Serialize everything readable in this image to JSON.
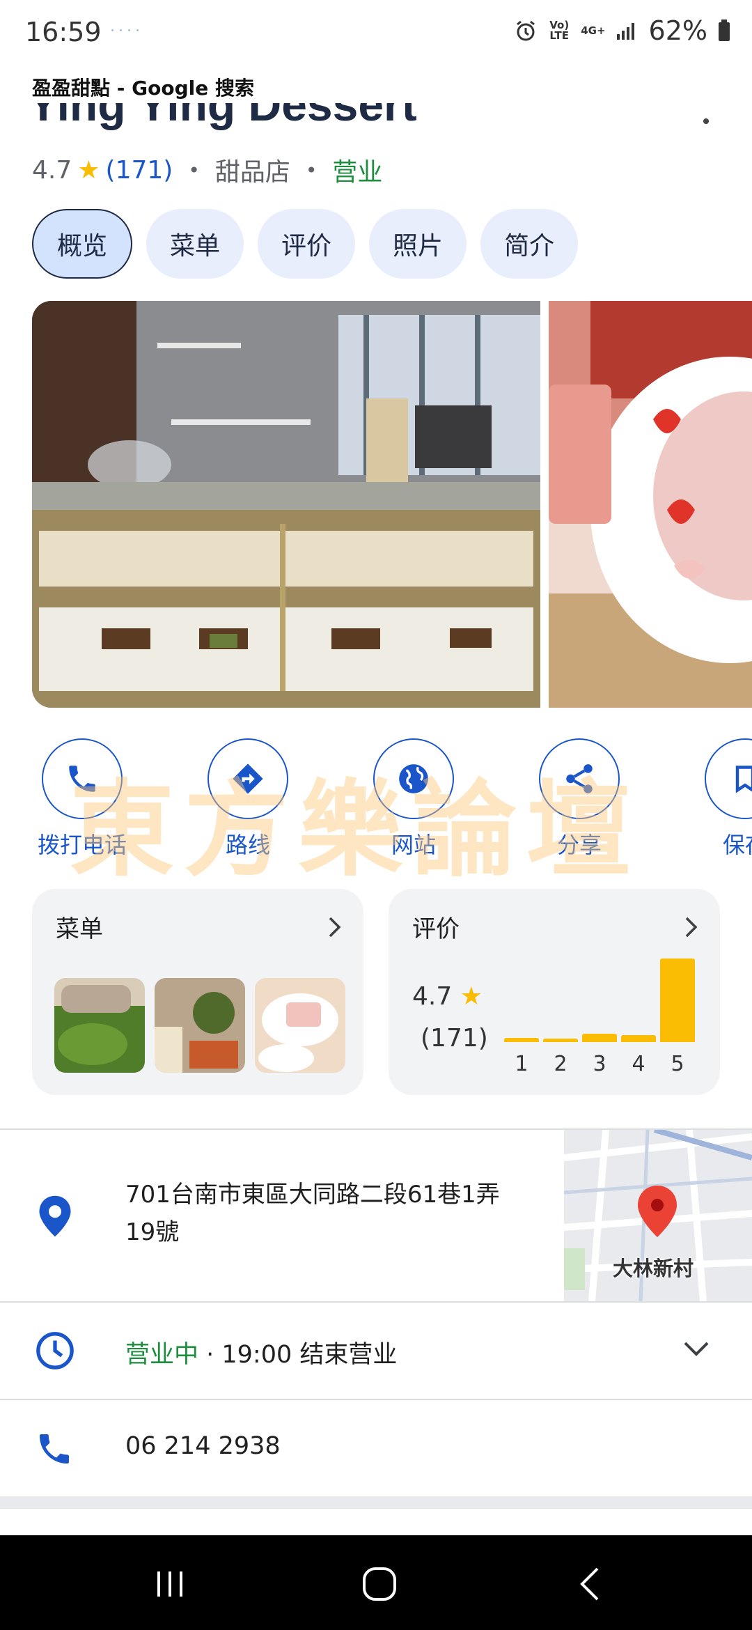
{
  "status_bar": {
    "time": "16:59",
    "dots": "˙˙˙˙",
    "volte": "Vo) LTE",
    "network": "4G+",
    "battery": "62%"
  },
  "header": {
    "title": "盈盈甜點 - Google 搜索",
    "business_name": "Ying Ying Dessert"
  },
  "rating_row": {
    "rating": "4.7",
    "count": "(171)",
    "category": "甜品店",
    "status": "营业"
  },
  "tabs": [
    {
      "label": "概览",
      "active": true
    },
    {
      "label": "菜单"
    },
    {
      "label": "评价"
    },
    {
      "label": "照片"
    },
    {
      "label": "简介"
    }
  ],
  "actions": [
    {
      "label": "拨打电话",
      "icon": "phone-icon"
    },
    {
      "label": "路线",
      "icon": "directions-icon"
    },
    {
      "label": "网站",
      "icon": "globe-icon"
    },
    {
      "label": "分享",
      "icon": "share-icon"
    },
    {
      "label": "保存",
      "icon": "bookmark-icon"
    }
  ],
  "watermark": "東方樂論壇",
  "menu_card": {
    "title": "菜单"
  },
  "reviews_card": {
    "title": "评价",
    "rating": "4.7",
    "count": "(171)",
    "distribution": [
      {
        "label": "1",
        "value": 0.05
      },
      {
        "label": "2",
        "value": 0.04
      },
      {
        "label": "3",
        "value": 0.1
      },
      {
        "label": "4",
        "value": 0.08
      },
      {
        "label": "5",
        "value": 1.0
      }
    ]
  },
  "address": {
    "line1": "701台南市東區大同路二段61巷1弄",
    "line2": "19號",
    "map_label": "大林新村"
  },
  "hours": {
    "open": "营业中",
    "rest": " · 19:00 结束营业"
  },
  "phone": {
    "number": "06 214 2938"
  },
  "colors": {
    "accent": "#1a56c9",
    "star": "#fbbc04",
    "open_green": "#1e8e3e"
  }
}
